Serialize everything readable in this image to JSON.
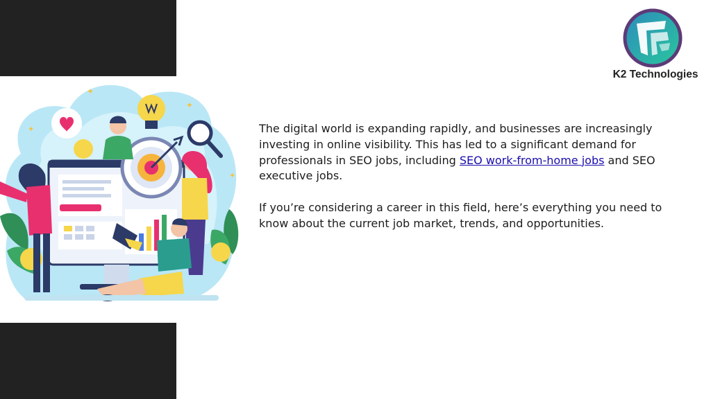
{
  "brand": {
    "name": "K2 Technologies",
    "logo_icon": "k2-technologies-logo-icon",
    "colors": {
      "ring": "#5e3a78",
      "fill_start": "#2e8bbd",
      "fill_end": "#29c79c"
    }
  },
  "illustration": {
    "icon": "seo-team-illustration"
  },
  "article": {
    "para1_before": "The digital world is expanding rapidly, and businesses are increasingly investing in online visibility. This has led to a significant demand for professionals in SEO jobs, including ",
    "para1_link": "SEO work-from-home jobs",
    "para1_after": " and SEO executive jobs.",
    "para2": "If you’re considering a career in this field, here’s everything you need to know about the current job market, trends, and opportunities."
  }
}
